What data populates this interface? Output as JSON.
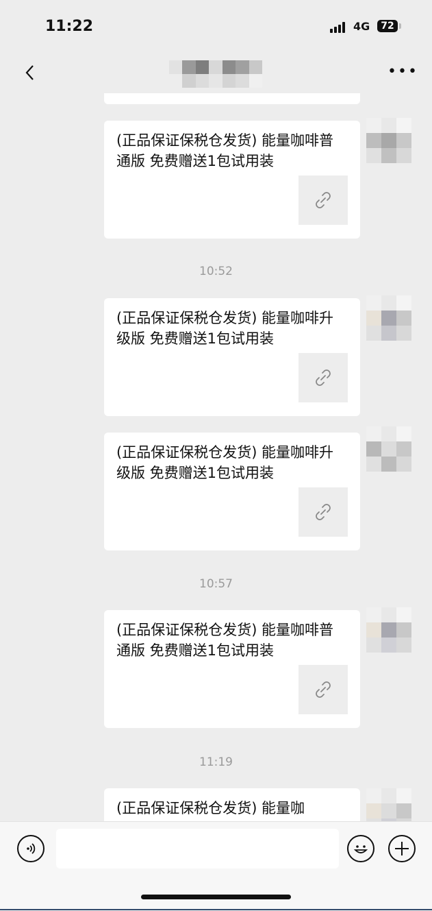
{
  "status_bar": {
    "time": "11:22",
    "network": "4G",
    "battery": "72"
  },
  "nav": {
    "back_icon": "chevron-left-icon",
    "title_pixelated": true,
    "more_icon": "more-dots-icon"
  },
  "messages": [
    {
      "type": "partial-bubble"
    },
    {
      "type": "link",
      "text": "(正品保证保税仓发货) 能量咖啡普通版 免费赠送1包试用装",
      "icon": "link-icon"
    },
    {
      "type": "timestamp",
      "text": "10:52"
    },
    {
      "type": "link",
      "text": "(正品保证保税仓发货) 能量咖啡升级版 免费赠送1包试用装",
      "icon": "link-icon"
    },
    {
      "type": "link",
      "text": "(正品保证保税仓发货) 能量咖啡升级版 免费赠送1包试用装",
      "icon": "link-icon"
    },
    {
      "type": "timestamp",
      "text": "10:57"
    },
    {
      "type": "link",
      "text": "(正品保证保税仓发货) 能量咖啡普通版 免费赠送1包试用装",
      "icon": "link-icon"
    },
    {
      "type": "timestamp",
      "text": "11:19"
    },
    {
      "type": "link",
      "text": "(正品保证保税仓发货) 能量咖",
      "icon": "link-icon"
    }
  ],
  "input_bar": {
    "voice_icon": "voice-icon",
    "emoji_icon": "emoji-icon",
    "plus_icon": "plus-icon",
    "text_value": ""
  }
}
